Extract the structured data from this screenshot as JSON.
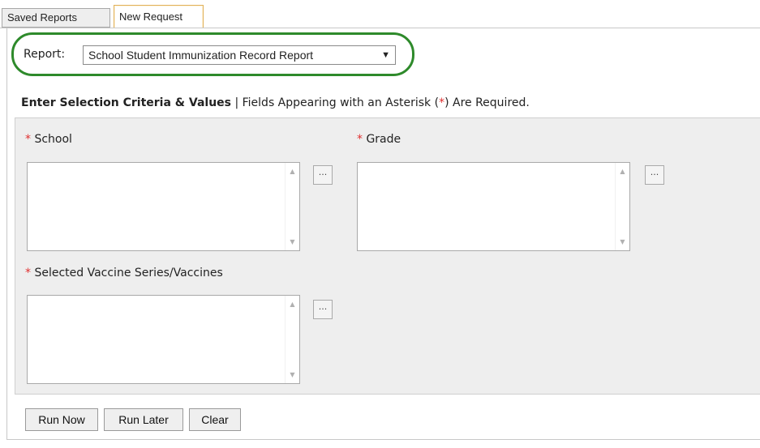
{
  "tabs": [
    {
      "label": "Saved Reports"
    },
    {
      "label": "New Request"
    }
  ],
  "report": {
    "label": "Report:",
    "selected": "School Student Immunization Record Report",
    "arrow": "▼"
  },
  "criteria": {
    "heading": "Enter Selection Criteria & Values",
    "separator": "|",
    "note_prefix": "Fields Appearing with an Asterisk (",
    "asterisk": "*",
    "note_suffix": ") Are Required."
  },
  "fields": {
    "school": {
      "label": "School"
    },
    "grade": {
      "label": "Grade"
    },
    "vaccines": {
      "label": "Selected Vaccine Series/Vaccines"
    }
  },
  "ellipsis": "...",
  "buttons": {
    "run_now": "Run Now",
    "run_later": "Run Later",
    "clear": "Clear"
  },
  "colors": {
    "highlight_ring": "#2e8a2b",
    "required": "#e03030",
    "panel_bg": "#eeeeee"
  }
}
